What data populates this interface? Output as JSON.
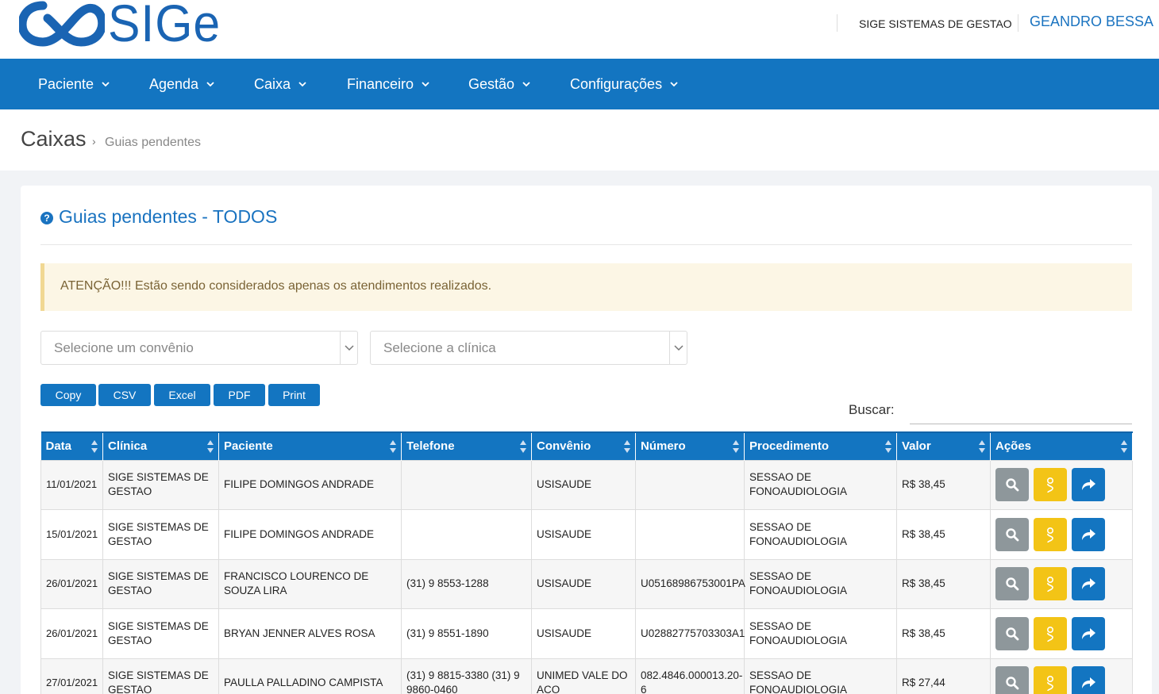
{
  "header": {
    "logo_text": "SIGe",
    "company": "SIGE SISTEMAS DE GESTAO",
    "user": "GEANDRO BESSA"
  },
  "nav": {
    "items": [
      {
        "label": "Paciente"
      },
      {
        "label": "Agenda"
      },
      {
        "label": "Caixa"
      },
      {
        "label": "Financeiro"
      },
      {
        "label": "Gestão"
      },
      {
        "label": "Configurações"
      }
    ]
  },
  "breadcrumb": {
    "title": "Caixas",
    "separator": "›",
    "current": "Guias pendentes"
  },
  "card": {
    "title": "Guias pendentes - TODOS",
    "alert_bold": "ATENÇÃO!!!",
    "alert_text": " Estão sendo considerados apenas os atendimentos realizados."
  },
  "filters": {
    "convenio_placeholder": "Selecione um convênio",
    "clinica_placeholder": "Selecione a clínica"
  },
  "export_buttons": {
    "copy": "Copy",
    "csv": "CSV",
    "excel": "Excel",
    "pdf": "PDF",
    "print": "Print"
  },
  "search": {
    "label": "Buscar:"
  },
  "table": {
    "headers": [
      "Data",
      "Clínica",
      "Paciente",
      "Telefone",
      "Convênio",
      "Número",
      "Procedimento",
      "Valor",
      "Ações"
    ],
    "rows": [
      {
        "data": "11/01/2021",
        "clinica": "SIGE SISTEMAS DE GESTAO",
        "paciente": "FILIPE DOMINGOS ANDRADE",
        "telefone": "",
        "convenio": "USISAUDE",
        "numero": "",
        "procedimento": "SESSAO DE FONOAUDIOLOGIA",
        "valor": "R$ 38,45"
      },
      {
        "data": "15/01/2021",
        "clinica": "SIGE SISTEMAS DE GESTAO",
        "paciente": "FILIPE DOMINGOS ANDRADE",
        "telefone": "",
        "convenio": "USISAUDE",
        "numero": "",
        "procedimento": "SESSAO DE FONOAUDIOLOGIA",
        "valor": "R$ 38,45"
      },
      {
        "data": "26/01/2021",
        "clinica": "SIGE SISTEMAS DE GESTAO",
        "paciente": "FRANCISCO LOURENCO DE SOUZA LIRA",
        "telefone": "(31) 9 8553-1288",
        "convenio": "USISAUDE",
        "numero": "U05168986753001PA",
        "procedimento": "SESSAO DE FONOAUDIOLOGIA",
        "valor": "R$ 38,45"
      },
      {
        "data": "26/01/2021",
        "clinica": "SIGE SISTEMAS DE GESTAO",
        "paciente": "BRYAN JENNER ALVES ROSA",
        "telefone": "(31) 9 8551-1890",
        "convenio": "USISAUDE",
        "numero": "U02882775703303A1",
        "procedimento": "SESSAO DE FONOAUDIOLOGIA",
        "valor": "R$ 38,45"
      },
      {
        "data": "27/01/2021",
        "clinica": "SIGE SISTEMAS DE GESTAO",
        "paciente": "PAULLA PALLADINO CAMPISTA",
        "telefone": "(31) 9 8815-3380 (31) 9 9860-0460",
        "convenio": "UNIMED VALE DO ACO",
        "numero": "082.4846.000013.20-6",
        "procedimento": "SESSAO DE FONOAUDIOLOGIA",
        "valor": "R$ 27,44"
      }
    ]
  },
  "colors": {
    "primary": "#1375c1",
    "action_view": "#8e979b",
    "action_edit": "#f3c416",
    "action_forward": "#1375c1",
    "alert_bg": "#fcf6e5"
  },
  "icons": {
    "view": "search-icon",
    "edit": "pencil-icon",
    "forward": "share-arrow-icon"
  }
}
